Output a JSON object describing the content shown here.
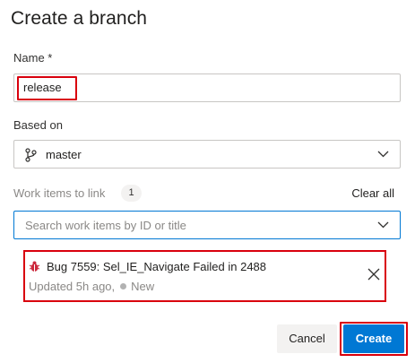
{
  "dialog": {
    "title": "Create a branch"
  },
  "name_field": {
    "label": "Name *",
    "value": "release"
  },
  "based_on": {
    "label": "Based on",
    "value": "master",
    "icon": "branch-icon"
  },
  "work_items": {
    "label": "Work items to link",
    "count": "1",
    "clear_all": "Clear all",
    "search_placeholder": "Search work items by ID or title",
    "items": [
      {
        "title": "Bug 7559: Sel_IE_Navigate Failed in 2488",
        "updated": "Updated 5h ago,",
        "state": "New",
        "icon": "bug-icon"
      }
    ]
  },
  "buttons": {
    "cancel": "Cancel",
    "create": "Create"
  },
  "colors": {
    "accent": "#0078d4",
    "highlight": "#d9000d",
    "bug": "#cc293d"
  }
}
